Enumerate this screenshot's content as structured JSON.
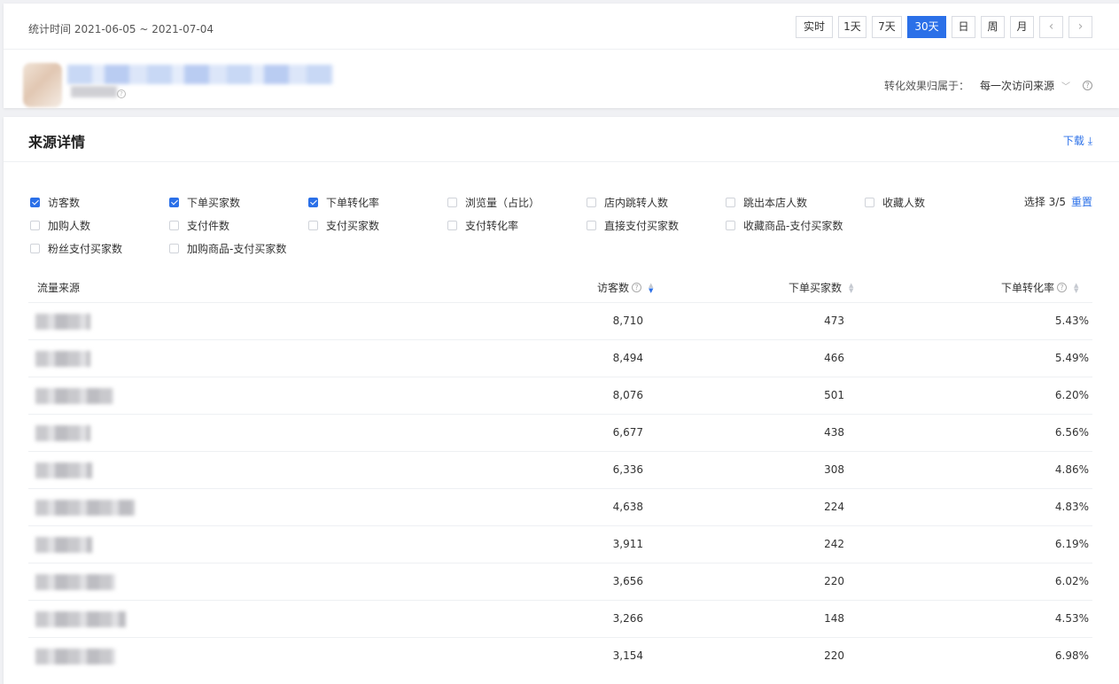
{
  "header": {
    "date_range": "统计时间 2021-06-05 ~ 2021-07-04",
    "periods": [
      "实时",
      "1天",
      "7天",
      "30天",
      "日",
      "周",
      "月"
    ],
    "active_period": "30天",
    "prev_icon": "chevron-left-icon",
    "next_icon": "chevron-right-icon"
  },
  "attribution": {
    "label": "转化效果归属于：",
    "value": "每一次访问来源"
  },
  "section": {
    "title": "来源详情",
    "download": "下载"
  },
  "metrics": [
    {
      "label": "访客数",
      "checked": true
    },
    {
      "label": "下单买家数",
      "checked": true
    },
    {
      "label": "下单转化率",
      "checked": true
    },
    {
      "label": "浏览量（占比）",
      "checked": false
    },
    {
      "label": "店内跳转人数",
      "checked": false
    },
    {
      "label": "跳出本店人数",
      "checked": false
    },
    {
      "label": "收藏人数",
      "checked": false
    },
    {
      "label": "加购人数",
      "checked": false
    },
    {
      "label": "支付件数",
      "checked": false
    },
    {
      "label": "支付买家数",
      "checked": false
    },
    {
      "label": "支付转化率",
      "checked": false
    },
    {
      "label": "直接支付买家数",
      "checked": false
    },
    {
      "label": "收藏商品-支付买家数",
      "checked": false
    },
    {
      "label": "粉丝支付买家数",
      "checked": false
    },
    {
      "label": "加购商品-支付买家数",
      "checked": false
    }
  ],
  "selection": {
    "count": "选择 3/5",
    "reset": "重置"
  },
  "table": {
    "columns": [
      "流量来源",
      "访客数",
      "下单买家数",
      "下单转化率"
    ],
    "rows": [
      {
        "visitors": "8,710",
        "buyers": "473",
        "rate": "5.43%"
      },
      {
        "visitors": "8,494",
        "buyers": "466",
        "rate": "5.49%"
      },
      {
        "visitors": "8,076",
        "buyers": "501",
        "rate": "6.20%"
      },
      {
        "visitors": "6,677",
        "buyers": "438",
        "rate": "6.56%"
      },
      {
        "visitors": "6,336",
        "buyers": "308",
        "rate": "4.86%"
      },
      {
        "visitors": "4,638",
        "buyers": "224",
        "rate": "4.83%"
      },
      {
        "visitors": "3,911",
        "buyers": "242",
        "rate": "6.19%"
      },
      {
        "visitors": "3,656",
        "buyers": "220",
        "rate": "6.02%"
      },
      {
        "visitors": "3,266",
        "buyers": "148",
        "rate": "4.53%"
      },
      {
        "visitors": "3,154",
        "buyers": "220",
        "rate": "6.98%"
      }
    ]
  },
  "colors": {
    "accent": "#2b70e8",
    "text": "#333333",
    "divider": "#eef0f3"
  }
}
